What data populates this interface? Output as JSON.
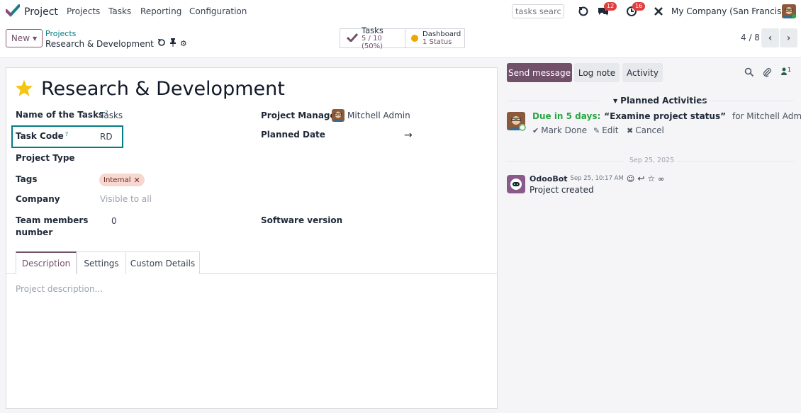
{
  "app": {
    "name": "Project"
  },
  "menu": [
    {
      "label": "Projects"
    },
    {
      "label": "Tasks"
    },
    {
      "label": "Reporting"
    },
    {
      "label": "Configuration"
    }
  ],
  "systray": {
    "search_placeholder": "tasks search",
    "messages_badge": "12",
    "activities_badge": "16",
    "company": "My Company (San Francisco)"
  },
  "control_panel": {
    "new_label": "New",
    "breadcrumb_parent": "Projects",
    "breadcrumb_current": "Research & Development",
    "tasks_button": {
      "label": "Tasks",
      "sub": "5 / 10 (50%)"
    },
    "dashboard_button": {
      "label": "Dashboard",
      "sub": "1 Status",
      "status_color": "#f0a500"
    },
    "pager": "4 / 8"
  },
  "form": {
    "title": "Research & Development",
    "fields": {
      "name_of_tasks_label": "Name of the Tasks",
      "name_of_tasks_value": "Tasks",
      "task_code_label": "Task Code",
      "task_code_value": "RD",
      "project_type_label": "Project Type",
      "tags_label": "Tags",
      "tag_internal": "Internal",
      "company_label": "Company",
      "company_placeholder": "Visible to all",
      "team_members_label_1": "Team members",
      "team_members_label_2": "number",
      "team_members_value": "0",
      "project_manager_label": "Project Manager",
      "project_manager_value": "Mitchell Admin",
      "planned_date_label": "Planned Date",
      "planned_date_arrow": "→",
      "software_version_label": "Software version"
    },
    "help_mark": "?",
    "tabs": [
      {
        "label": "Description"
      },
      {
        "label": "Settings"
      },
      {
        "label": "Custom Details"
      }
    ],
    "description_placeholder": "Project description..."
  },
  "chatter": {
    "send_message": "Send message",
    "log_note": "Log note",
    "activity": "Activity",
    "followers_count": "1",
    "planned_activities": "Planned Activities",
    "activity_due": "Due in 5 days:",
    "activity_summary": "“Examine project status”",
    "activity_for": "for Mitchell Admin",
    "mark_done": "Mark Done",
    "edit": "Edit",
    "cancel": "Cancel",
    "date_separator": "Sep 25, 2025",
    "message_author": "OdooBot",
    "message_time": "Sep 25, 10:17 AM",
    "message_body": "Project created"
  },
  "colors": {
    "brand": "#71506a",
    "accent": "#017e84",
    "star": "#f3c614",
    "due_green": "#28a745"
  }
}
